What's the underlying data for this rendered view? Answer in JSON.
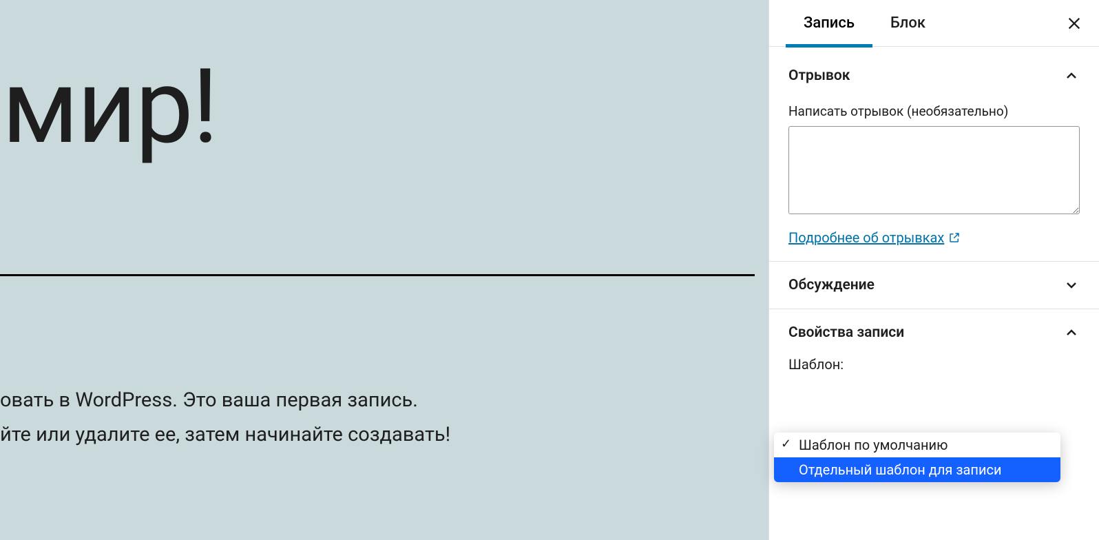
{
  "editor": {
    "title": ", мир!",
    "body_line1": "овать в WordPress. Это ваша первая запись.",
    "body_line2": "йте или удалите ее, затем начинайте создавать!"
  },
  "sidebar": {
    "tabs": {
      "document": "Запись",
      "block": "Блок"
    },
    "panels": {
      "excerpt": {
        "title": "Отрывок",
        "label": "Написать отрывок (необязательно)",
        "value": "",
        "help_link": "Подробнее об отрывках"
      },
      "discussion": {
        "title": "Обсуждение"
      },
      "attributes": {
        "title": "Свойства записи",
        "template_label": "Шаблон:",
        "template_options": [
          "Шаблон по умолчанию",
          "Отдельный шаблон для записи"
        ],
        "template_selected": 0,
        "template_hovered": 1
      }
    }
  }
}
